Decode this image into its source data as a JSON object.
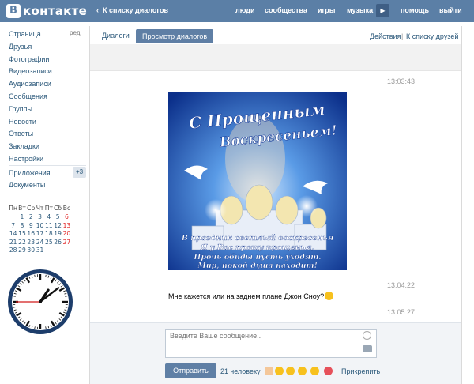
{
  "header": {
    "logo_letter": "В",
    "logo_text": "контакте",
    "back_chevron": "‹",
    "back_label": "К списку диалогов",
    "nav": [
      "люди",
      "сообщества",
      "игры",
      "музыка",
      "помощь",
      "выйти"
    ],
    "play_icon": "▶"
  },
  "leftnav": {
    "items": [
      "Страница",
      "Друзья",
      "Фотографии",
      "Видеозаписи",
      "Аудиозаписи",
      "Сообщения",
      "Группы",
      "Новости",
      "Ответы",
      "Закладки",
      "Настройки"
    ],
    "edit_label": "ред.",
    "apps_label": "Приложения",
    "apps_badge": "+3",
    "docs_label": "Документы"
  },
  "calendar": {
    "weekdays": [
      "Пн",
      "Вт",
      "Ср",
      "Чт",
      "Пт",
      "Сб",
      "Вс"
    ],
    "weeks": [
      [
        "",
        "1",
        "2",
        "3",
        "4",
        "5",
        "6"
      ],
      [
        "7",
        "8",
        "9",
        "10",
        "11",
        "12",
        "13"
      ],
      [
        "14",
        "15",
        "16",
        "17",
        "18",
        "19",
        "20"
      ],
      [
        "21",
        "22",
        "23",
        "24",
        "25",
        "26",
        "27"
      ],
      [
        "28",
        "29",
        "30",
        "31",
        "",
        "",
        ""
      ]
    ],
    "weekend_color": "#e02020"
  },
  "clock": {
    "hours": 1,
    "minutes": 8,
    "seconds": 45
  },
  "main": {
    "tab_dialogs": "Диалоги",
    "tab_view": "Просмотр диалогов",
    "actions": "Действия",
    "separator": "|",
    "to_friends": "К списку друзей",
    "messages": [
      {
        "time": "13:03:43"
      },
      {
        "time": "13:04:22",
        "text": "Мне кажется или на заднем плане Джон Сноу?"
      },
      {
        "time": "13:05:27"
      }
    ],
    "postcard": {
      "title_line1": "С Прощенным",
      "title_line2": "Воскресеньем!",
      "verse": [
        "В праздник светлый воскресенья",
        "Я у Вас прошу прощенья,",
        "Прочь обиды пусть уходят.",
        "Мир, покой душа находит!"
      ]
    }
  },
  "composer": {
    "placeholder": "Введите Ваше сообщение..",
    "send_label": "Отправить",
    "people_count": "21 человеку",
    "attach_label": "Прикрепить"
  },
  "colors": {
    "header": "#5b7fa6",
    "link": "#2b587a",
    "button": "#5f7fa5"
  }
}
